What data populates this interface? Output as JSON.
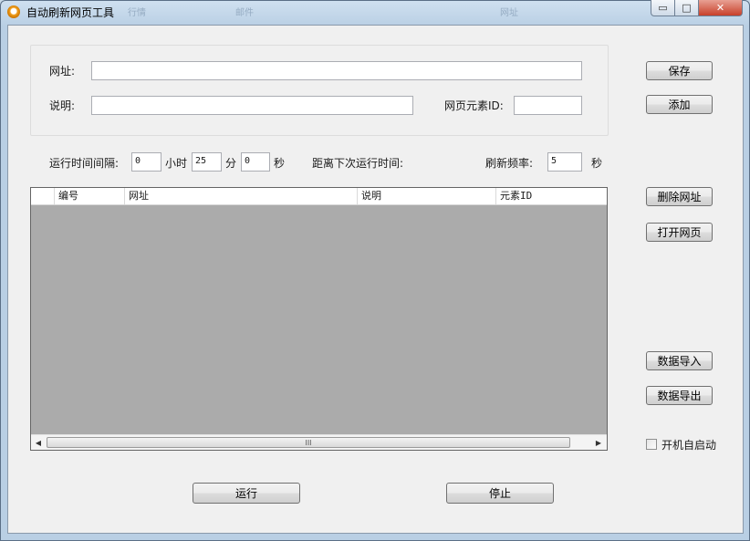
{
  "window": {
    "title": "自动刷新网页工具",
    "background_tabs": [
      "行情",
      "邮件",
      "网址"
    ],
    "caption_buttons": {
      "minimize": "▭",
      "maximize": "□",
      "close": "✕"
    }
  },
  "url_group": {
    "url_label": "网址:",
    "url_value": "",
    "desc_label": "说明:",
    "desc_value": "",
    "element_id_label": "网页元素ID:",
    "element_id_value": ""
  },
  "schedule": {
    "interval_label": "运行时间间隔:",
    "hours_value": "0",
    "hours_unit": "小时",
    "minutes_value": "25",
    "minutes_unit": "分",
    "seconds_value": "0",
    "seconds_unit": "秒",
    "next_run_label": "距离下次运行时间:",
    "refresh_rate_label": "刷新频率:",
    "refresh_rate_value": "5",
    "refresh_rate_unit": "秒"
  },
  "table": {
    "columns": [
      "编号",
      "网址",
      "说明",
      "元素ID"
    ],
    "rows": [],
    "scroll_thumb_glyph": "III"
  },
  "buttons": {
    "save": "保存",
    "add": "添加",
    "delete_url": "删除网址",
    "open_page": "打开网页",
    "import_data": "数据导入",
    "export_data": "数据导出",
    "run": "运行",
    "stop": "停止"
  },
  "autostart": {
    "label": "开机自启动",
    "checked": false
  },
  "colors": {
    "grid_background": "#ababab",
    "window_face": "#f0f0f0",
    "close_button": "#c7402a"
  }
}
